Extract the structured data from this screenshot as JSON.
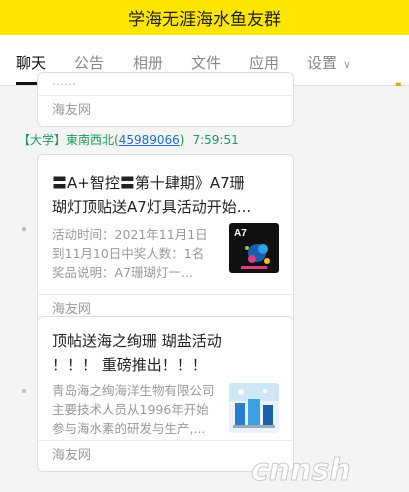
{
  "window": {
    "title": "学海无涯海水鱼友群"
  },
  "tabs": [
    {
      "label": "聊天"
    },
    {
      "label": "公告"
    },
    {
      "label": "相册"
    },
    {
      "label": "文件"
    },
    {
      "label": "应用"
    },
    {
      "label": "设置"
    }
  ],
  "icons": {
    "settings_chevron": "chevron-down-icon",
    "phone": "phone-icon"
  },
  "messages": [
    {
      "source": "海友网",
      "partial_text": "......"
    },
    {
      "sender_prefix": "【大学】",
      "sender_name": "東南西北",
      "sender_qq_open": "(",
      "sender_qq": "45989066",
      "sender_qq_close": ")",
      "time": "7:59:51",
      "title_line1": "〓A+智控〓第十肆期》A7珊",
      "title_line2": "瑚灯顶贴送A7灯具活动开始...",
      "desc_line1": "活动时间：2021年11月1日",
      "desc_line2": "到11月10日中奖人数：1名",
      "desc_line3": "奖品说明：A7珊瑚灯一...",
      "thumb_text": "A7",
      "source": "海友网"
    },
    {
      "title_line1": "顶帖送海之绚珊 瑚盐活动",
      "title_line2": "！！！ 重磅推出！！！",
      "desc_line1": "青岛海之绚海洋生物有限公司",
      "desc_line2": "主要技术人员从1996年开始",
      "desc_line3": "参与海水素的研发与生产,...",
      "source": "海友网"
    }
  ],
  "watermark": {
    "text": "cnnsh"
  },
  "colors": {
    "titlebar": "#ffe600",
    "sender": "#1b9a58",
    "qq_link": "#1e6fc8",
    "phone": "#f3a400"
  }
}
